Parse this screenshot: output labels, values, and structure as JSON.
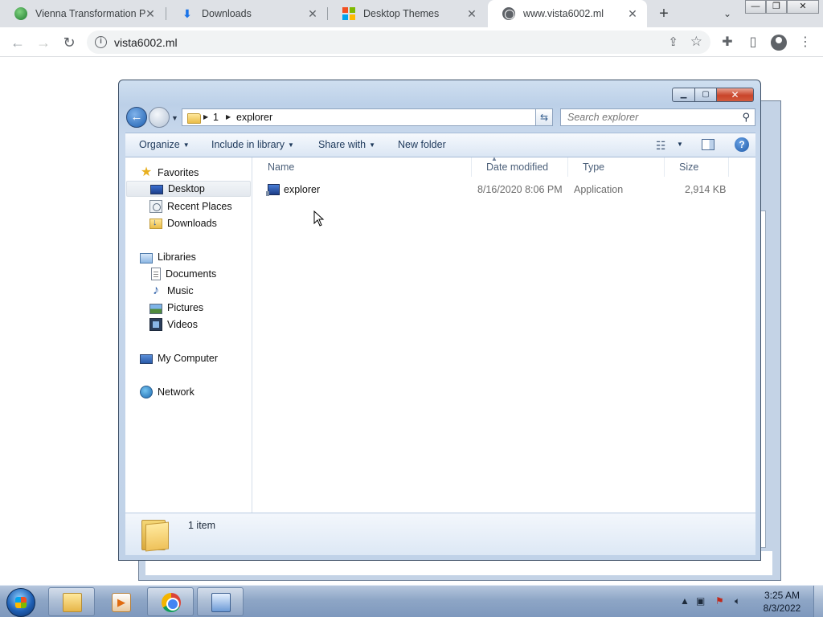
{
  "browser": {
    "tabs": [
      {
        "title": "Vienna Transformation Pa",
        "favicon": "green-globe-icon",
        "active": false
      },
      {
        "title": "Downloads",
        "favicon": "download-icon",
        "active": false
      },
      {
        "title": "Desktop Themes",
        "favicon": "microsoft-logo-icon",
        "active": false
      },
      {
        "title": "www.vista6002.ml",
        "favicon": "globe-icon",
        "active": true
      }
    ],
    "url": "vista6002.ml"
  },
  "explorer": {
    "breadcrumb": [
      "1",
      "explorer"
    ],
    "search_placeholder": "Search explorer",
    "commands": {
      "organize": "Organize",
      "include_in_library": "Include in library",
      "share_with": "Share with",
      "new_folder": "New folder"
    },
    "nav": {
      "favorites": "Favorites",
      "desktop": "Desktop",
      "recent_places": "Recent Places",
      "downloads": "Downloads",
      "libraries": "Libraries",
      "documents": "Documents",
      "music": "Music",
      "pictures": "Pictures",
      "videos": "Videos",
      "my_computer": "My Computer",
      "network": "Network"
    },
    "columns": {
      "name": "Name",
      "date_modified": "Date modified",
      "type": "Type",
      "size": "Size"
    },
    "files": [
      {
        "name": "explorer",
        "date_modified": "8/16/2020 8:06 PM",
        "type": "Application",
        "size": "2,914 KB"
      }
    ],
    "status": "1 item"
  },
  "taskbar": {
    "clock_time": "3:25 AM",
    "clock_date": "8/3/2022"
  },
  "colors": {
    "window_frame": "#bcd0e8",
    "close_button": "#c9442a",
    "taskbar": "#8ea6c6"
  }
}
